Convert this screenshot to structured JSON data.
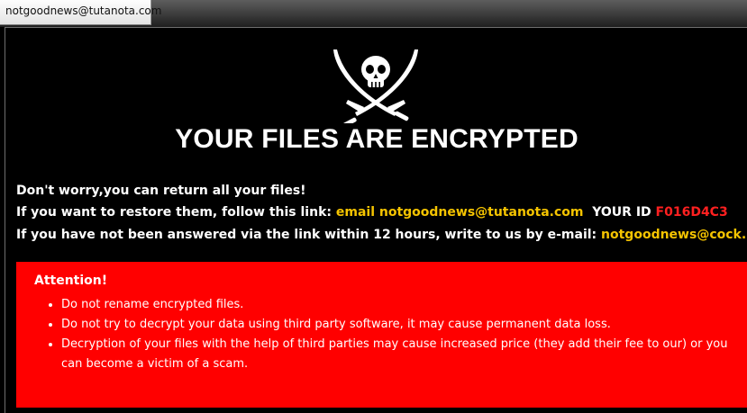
{
  "window": {
    "title": "notgoodnews@tutanota.com"
  },
  "logo": {
    "icon": "skull-crossed-swords-icon"
  },
  "headline": "YOUR FILES ARE ENCRYPTED",
  "message": {
    "line1": "Don't worry,you can return all your files!",
    "line2_prefix": "If you want to restore them, follow this link: ",
    "line2_link": "email notgoodnews@tutanota.com",
    "line2_id_label": "YOUR ID ",
    "line2_id_value": "F016D4C3",
    "line3_prefix": "If you have not been answered via the link within 12 hours, write to us by e-mail: ",
    "line3_email": "notgoodnews@cock.li"
  },
  "attention": {
    "title": "Attention!",
    "items": [
      "Do not rename encrypted files.",
      "Do not try to decrypt your data using third party software, it may cause permanent data loss.",
      "Decryption of your files with the help of third parties may cause increased price (they add their fee to our) or you can become a victim of a scam."
    ]
  },
  "colors": {
    "background": "#000000",
    "headline": "#ffffff",
    "link": "#f5c400",
    "id_value": "#ff2020",
    "attention_box": "#ff0000"
  }
}
